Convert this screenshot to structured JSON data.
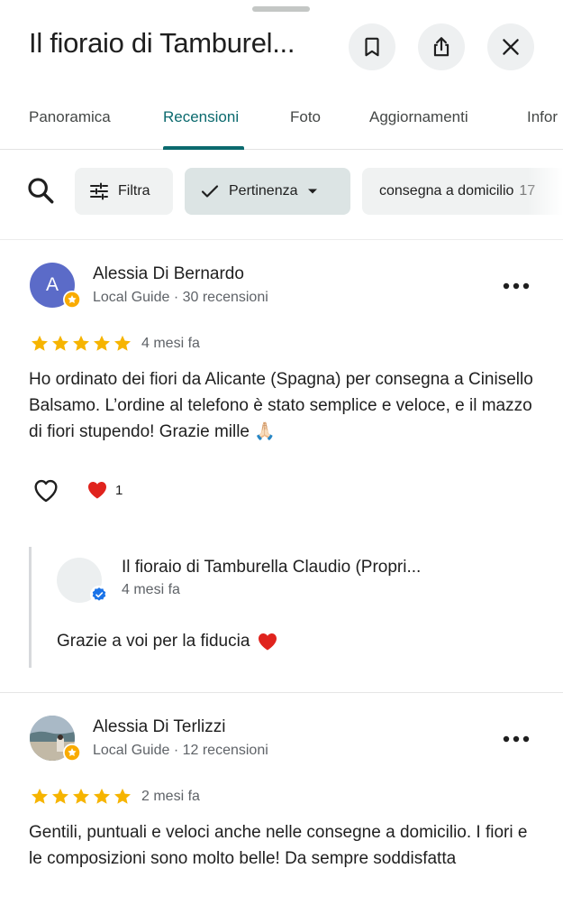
{
  "header": {
    "title": "Il fioraio di Tamburel...",
    "buttons": {
      "save": "bookmark-icon",
      "share": "share-icon",
      "close": "close-icon"
    }
  },
  "tabs": [
    {
      "label": "Panoramica"
    },
    {
      "label": "Recensioni",
      "active": true
    },
    {
      "label": "Foto"
    },
    {
      "label": "Aggiornamenti"
    },
    {
      "label": "Infor"
    }
  ],
  "filters": {
    "filter_label": "Filtra",
    "sort_label": "Pertinenza",
    "topic_label": "consegna a domicilio",
    "topic_count": "17"
  },
  "reviews": [
    {
      "avatar_letter": "A",
      "name": "Alessia Di Bernardo",
      "meta": "Local Guide · 30 recensioni",
      "rating": 5,
      "date": "4 mesi fa",
      "text": "Ho ordinato dei fiori da Alicante (Spagna) per consegna a Cinisello Balsamo. L’ordine al telefono è stato semplice e veloce, e il mazzo di fiori stupendo! Grazie mille 🙏🏻",
      "reaction_count": "1",
      "owner_reply": {
        "name": "Il fioraio di Tamburella Claudio (Propri...",
        "date": "4 mesi fa",
        "text": "Grazie a voi per la fiducia"
      }
    },
    {
      "name": "Alessia Di Terlizzi",
      "meta": "Local Guide · 12 recensioni",
      "rating": 5,
      "date": "2 mesi fa",
      "text": "Gentili, puntuali e veloci anche nelle consegne a domicilio. I fiori e le composizioni sono molto belle! Da sempre soddisfatta"
    }
  ],
  "colors": {
    "accent": "#0b6a6e",
    "star": "#f6b400",
    "heart": "#e0231d",
    "local_guide_badge": "#f9ab00",
    "verified_badge": "#1a73e8"
  }
}
